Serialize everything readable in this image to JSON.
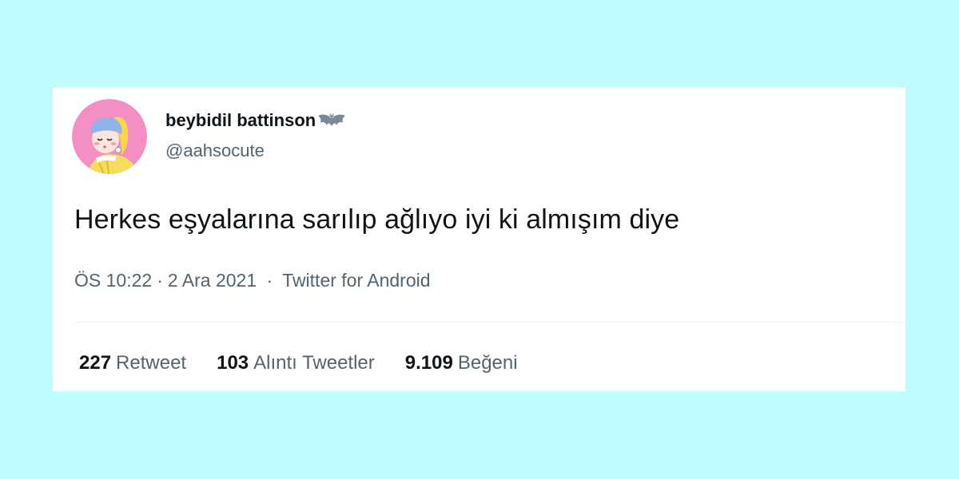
{
  "colors": {
    "background": "#c0fcfe",
    "card": "#ffffff",
    "primary_text": "#0f1419",
    "secondary_text": "#536471"
  },
  "tweet": {
    "author": {
      "display_name": "beybidil battinson",
      "name_emoji_icon": "bat-icon",
      "handle": "@aahsocute",
      "avatar_icon": "girl-with-pearl-earring-avatar"
    },
    "text": "Herkes eşyalarına sarılıp ağlıyo iyi ki almışım diye",
    "time": "ÖS 10:22",
    "date": "2 Ara 2021",
    "source": "Twitter for Android",
    "separator": "·",
    "stats": {
      "retweets": {
        "count": "227",
        "label": "Retweet"
      },
      "quotes": {
        "count": "103",
        "label": "Alıntı Tweetler"
      },
      "likes": {
        "count": "9.109",
        "label": "Beğeni"
      }
    }
  }
}
